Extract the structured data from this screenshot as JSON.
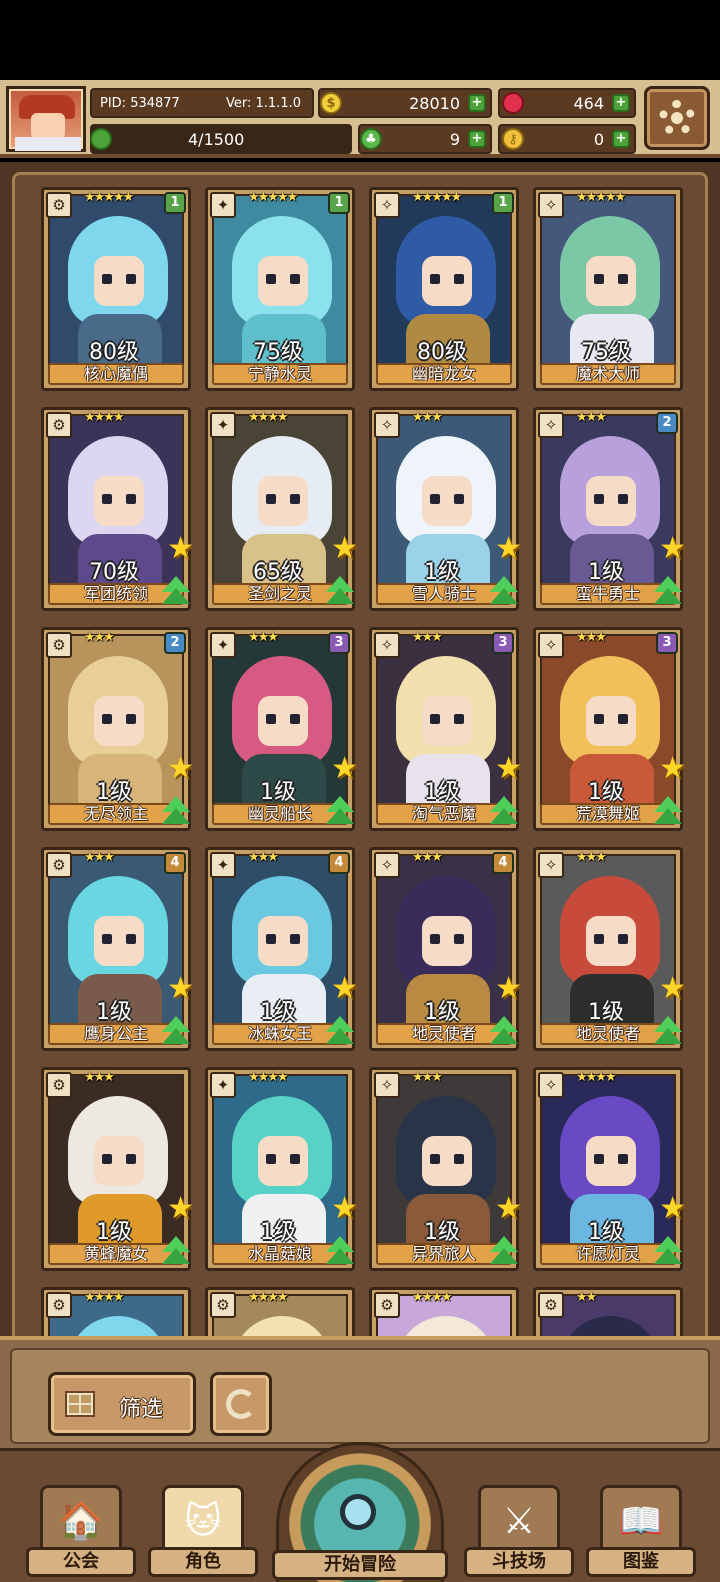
{
  "hud": {
    "pid": "PID: 534877",
    "version": "Ver: 1.1.1.0",
    "gold": "28010",
    "gems": "464",
    "exp": "4/1500",
    "clover": "9",
    "key": "0"
  },
  "cards": [
    {
      "name": "核心魔偶",
      "level": "80级",
      "stars": "★★★★★",
      "badge": "1",
      "badge_color": "#59a44a",
      "hair": "#7fd7ee",
      "body": "#4a6a8a",
      "bg": "#2f4a6a",
      "upgrade": false
    },
    {
      "name": "宁静水灵",
      "level": "75级",
      "stars": "★★★★★",
      "badge": "1",
      "badge_color": "#59a44a",
      "hair": "#8be2ec",
      "body": "#5fc0cc",
      "bg": "#3e8aa0",
      "upgrade": false
    },
    {
      "name": "幽暗龙女",
      "level": "80级",
      "stars": "★★★★★",
      "badge": "1",
      "badge_color": "#59a44a",
      "hair": "#2e5aa6",
      "body": "#b08a42",
      "bg": "#213a5a",
      "upgrade": false
    },
    {
      "name": "魔术大师",
      "level": "75级",
      "stars": "★★★★★",
      "badge": "",
      "badge_color": "",
      "hair": "#7cc8a6",
      "body": "#e8e8f2",
      "bg": "#43587a",
      "upgrade": false
    },
    {
      "name": "军团统领",
      "level": "70级",
      "stars": "★★★★",
      "badge": "",
      "badge_color": "",
      "hair": "#dcd6f0",
      "body": "#5e4a8a",
      "bg": "#3b3358",
      "upgrade": true
    },
    {
      "name": "圣剑之灵",
      "level": "65级",
      "stars": "★★★★",
      "badge": "",
      "badge_color": "",
      "hair": "#e6ecf4",
      "body": "#d8c28a",
      "bg": "#4a4436",
      "upgrade": true
    },
    {
      "name": "雪人骑士",
      "level": "1级",
      "stars": "★★★",
      "badge": "",
      "badge_color": "",
      "hair": "#eef4fa",
      "body": "#9ad2ea",
      "bg": "#3c5a78",
      "upgrade": true
    },
    {
      "name": "蛮牛勇士",
      "level": "1级",
      "stars": "★★★",
      "badge": "2",
      "badge_color": "#4a8ac4",
      "hair": "#b8a0dc",
      "body": "#6a5a94",
      "bg": "#3a3a5e",
      "upgrade": true
    },
    {
      "name": "无尽领主",
      "level": "1级",
      "stars": "★★★",
      "badge": "2",
      "badge_color": "#4a8ac4",
      "hair": "#e8cf98",
      "body": "#d6b47a",
      "bg": "#b8945c",
      "upgrade": true
    },
    {
      "name": "幽灵船长",
      "level": "1级",
      "stars": "★★★",
      "badge": "3",
      "badge_color": "#8a5ab4",
      "hair": "#d65a82",
      "body": "#2e4a48",
      "bg": "#243838",
      "upgrade": true
    },
    {
      "name": "淘气恶魔",
      "level": "1级",
      "stars": "★★★",
      "badge": "3",
      "badge_color": "#8a5ab4",
      "hair": "#f2dfae",
      "body": "#e8e2ec",
      "bg": "#3a3040",
      "upgrade": true
    },
    {
      "name": "荒漠舞姬",
      "level": "1级",
      "stars": "★★★",
      "badge": "3",
      "badge_color": "#8a5ab4",
      "hair": "#f2c05a",
      "body": "#c85a3a",
      "bg": "#8a4a2a",
      "upgrade": true
    },
    {
      "name": "鹰身公主",
      "level": "1级",
      "stars": "★★★",
      "badge": "4",
      "badge_color": "#c48a3a",
      "hair": "#6ad6e2",
      "body": "#7a5a4a",
      "bg": "#3a5a74",
      "upgrade": true
    },
    {
      "name": "冰蛛女王",
      "level": "1级",
      "stars": "★★★",
      "badge": "4",
      "badge_color": "#c48a3a",
      "hair": "#6ac8e0",
      "body": "#e8eef4",
      "bg": "#2e4e68",
      "upgrade": true
    },
    {
      "name": "地灵使者",
      "level": "1级",
      "stars": "★★★",
      "badge": "4",
      "badge_color": "#c48a3a",
      "hair": "#3a2c5a",
      "body": "#b88a42",
      "bg": "#3a3048",
      "upgrade": true
    },
    {
      "name": "地灵使者",
      "level": "1级",
      "stars": "★★★",
      "badge": "",
      "badge_color": "",
      "hair": "#c84a3a",
      "body": "#2e2e2e",
      "bg": "#5a5a5a",
      "upgrade": true
    },
    {
      "name": "黄蜂魔女",
      "level": "1级",
      "stars": "★★★",
      "badge": "",
      "badge_color": "",
      "hair": "#eee8e2",
      "body": "#e09a2a",
      "bg": "#3a2c22",
      "upgrade": true
    },
    {
      "name": "水晶菇娘",
      "level": "1级",
      "stars": "★★★★",
      "badge": "",
      "badge_color": "",
      "hair": "#58d2c6",
      "body": "#eef0f2",
      "bg": "#2e6a8a",
      "upgrade": true
    },
    {
      "name": "异界旅人",
      "level": "1级",
      "stars": "★★★",
      "badge": "",
      "badge_color": "",
      "hair": "#2a3448",
      "body": "#8a5a3a",
      "bg": "#3e3a3a",
      "upgrade": true
    },
    {
      "name": "许愿灯灵",
      "level": "1级",
      "stars": "★★★★",
      "badge": "",
      "badge_color": "",
      "hair": "#6a4ac4",
      "body": "#6ab8e0",
      "bg": "#2a2a5a",
      "upgrade": true
    }
  ],
  "partial_cards": [
    {
      "stars": "★★★★",
      "hair": "#7fd7ee",
      "bg": "#3e6a8a"
    },
    {
      "stars": "★★★★",
      "hair": "#f2e2b0",
      "bg": "#a48a5a"
    },
    {
      "stars": "★★★★",
      "hair": "#f4e8d8",
      "bg": "#c8a8d8"
    },
    {
      "stars": "★★",
      "hair": "#2a2a4a",
      "bg": "#4a3a6a"
    }
  ],
  "filter": {
    "label": "筛选"
  },
  "nav": {
    "guild": "公会",
    "character": "角色",
    "adventure": "开始冒险",
    "arena": "斗技场",
    "codex": "图鉴"
  }
}
